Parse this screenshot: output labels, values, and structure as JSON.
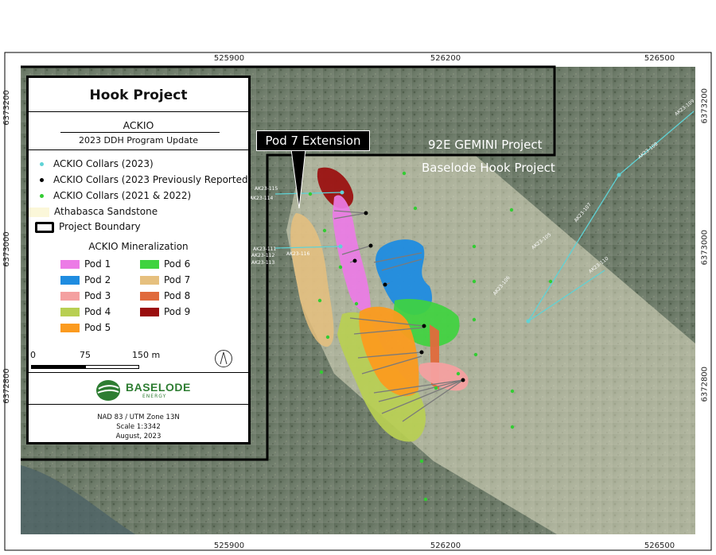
{
  "map": {
    "x_ticks": [
      "525900",
      "526200",
      "526500"
    ],
    "y_ticks": [
      "6373200",
      "6373000",
      "6372800"
    ],
    "callout_label": "Pod 7 Extension",
    "project_labels": [
      "92E GEMINI Project",
      "Baselode Hook Project"
    ],
    "collar_labels": [
      "AK23-115",
      "AK23-114",
      "AK23-111",
      "AK23-112",
      "AK23-113",
      "AK23-116",
      "AK23-109",
      "AK23-108",
      "AK23-107",
      "AK23-105",
      "AK23-106",
      "AK23-110"
    ]
  },
  "legend": {
    "title": "Hook Project",
    "subtitle": "ACKIO",
    "program": "2023 DDH Program Update",
    "items": [
      {
        "label": "ACKIO Collars (2023)",
        "color": "#5fd3d6"
      },
      {
        "label": "ACKIO Collars (2023 Previously Reported)",
        "color": "#000000"
      },
      {
        "label": "ACKIO Collars (2021 & 2022)",
        "color": "#33cc33"
      },
      {
        "label": "Athabasca Sandstone",
        "color": "#fbf7d9"
      },
      {
        "label": "Project Boundary",
        "color": "#000000"
      }
    ],
    "mineralization_title": "ACKIO Mineralization",
    "pods": [
      {
        "label": "Pod 1",
        "color": "#ec7be6"
      },
      {
        "label": "Pod 2",
        "color": "#1f8ce0"
      },
      {
        "label": "Pod 3",
        "color": "#f4a0a0"
      },
      {
        "label": "Pod 4",
        "color": "#b8cf52"
      },
      {
        "label": "Pod 5",
        "color": "#fb9b1f"
      },
      {
        "label": "Pod 6",
        "color": "#3fd33f"
      },
      {
        "label": "Pod 7",
        "color": "#e6c07e"
      },
      {
        "label": "Pod 8",
        "color": "#e06a3c"
      },
      {
        "label": "Pod 9",
        "color": "#9a0d0d"
      }
    ],
    "scale": {
      "labels": [
        "0",
        "75",
        "150 m"
      ]
    },
    "logo": {
      "name": "BASELODE",
      "sub": "ENERGY"
    },
    "footer": [
      "NAD 83 / UTM Zone 13N",
      "Scale 1:3342",
      "August, 2023"
    ]
  }
}
